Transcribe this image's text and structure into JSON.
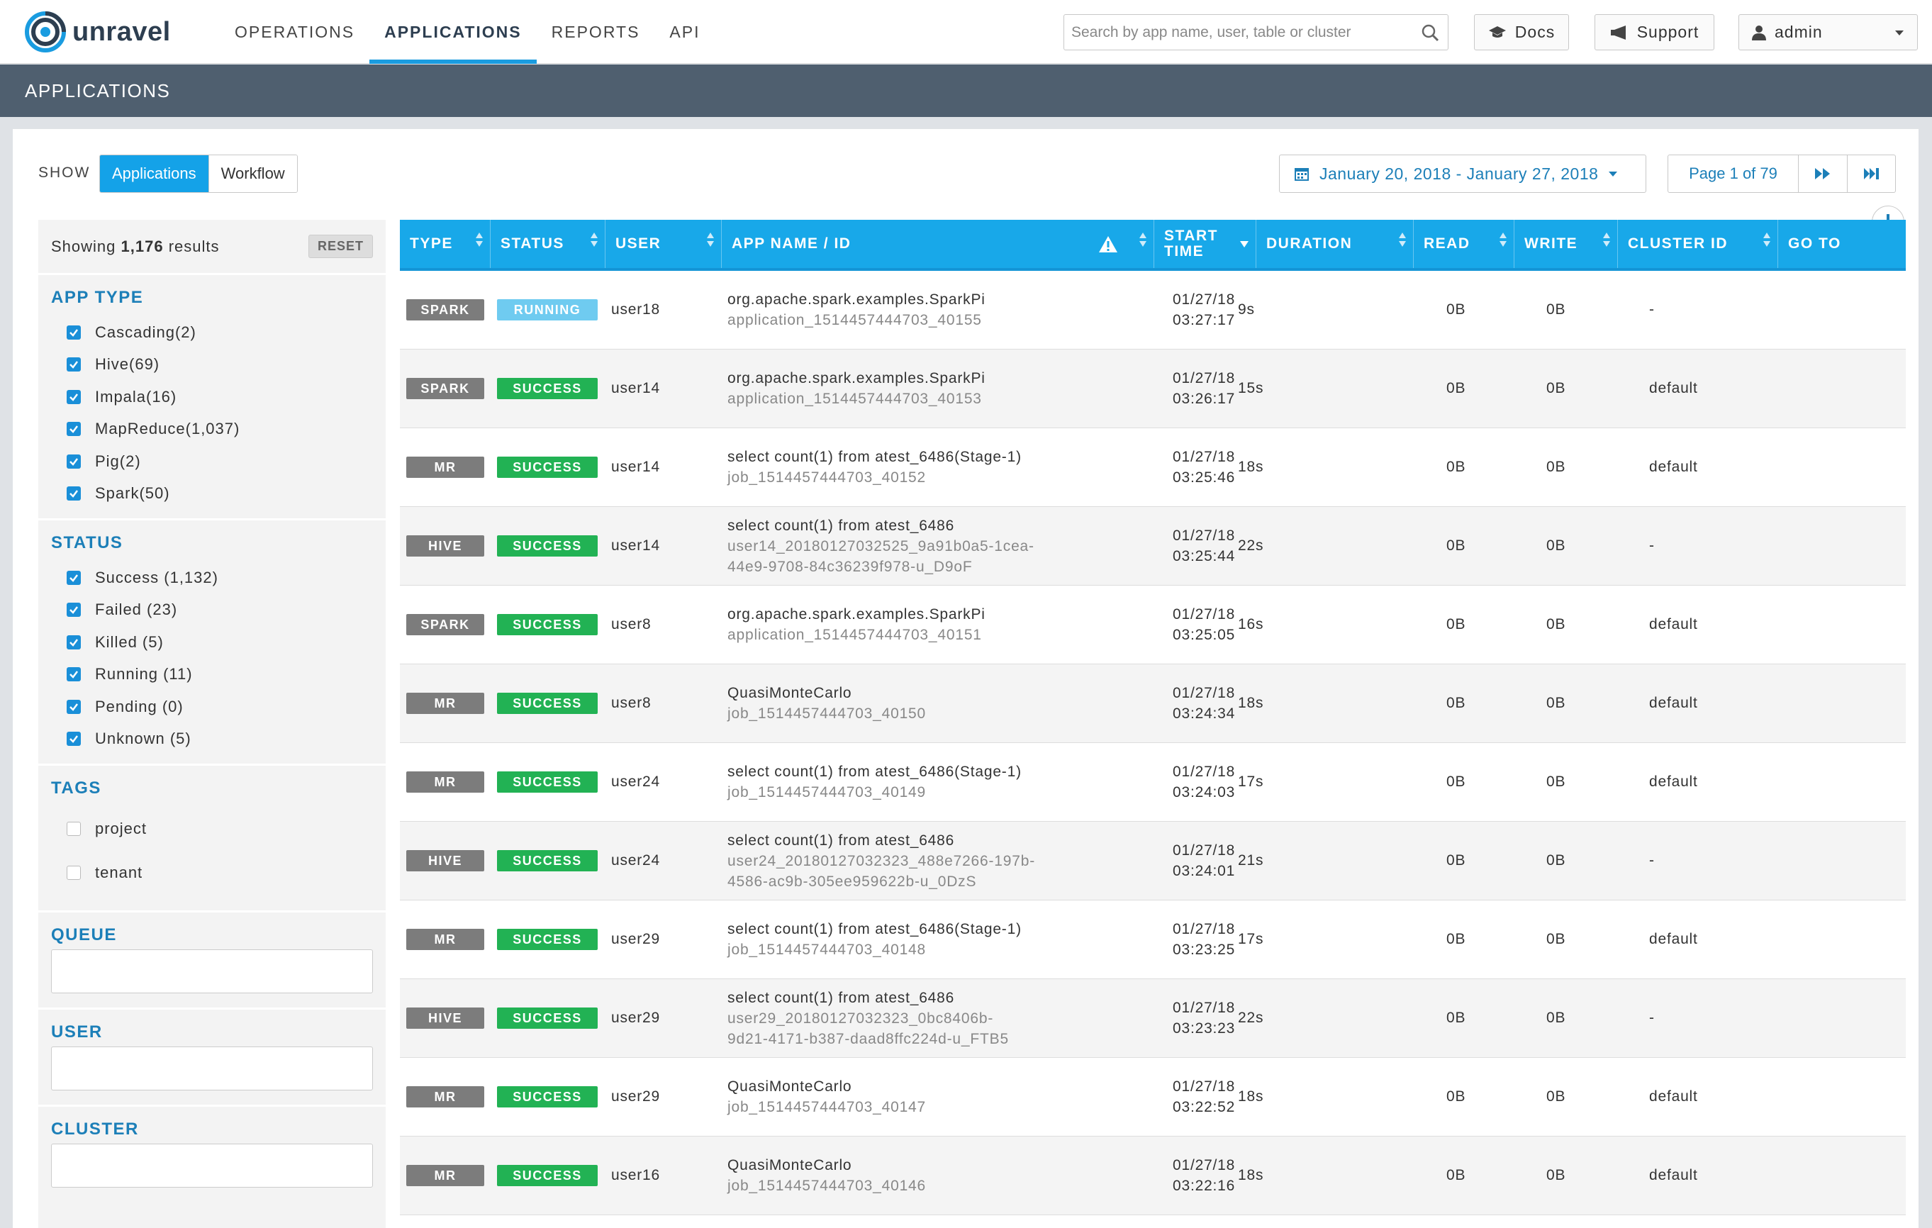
{
  "brand": {
    "name": "unravel"
  },
  "nav": {
    "items": [
      "OPERATIONS",
      "APPLICATIONS",
      "REPORTS",
      "API"
    ],
    "active_index": 1
  },
  "search": {
    "placeholder": "Search by app name, user, table or cluster"
  },
  "header_buttons": {
    "docs": "Docs",
    "support": "Support",
    "user": "admin"
  },
  "section_title": "APPLICATIONS",
  "toolbar": {
    "show_label": "SHOW",
    "show_options": [
      "Applications",
      "Workflow"
    ],
    "show_selected": "Applications",
    "date_range": "January 20, 2018 - January 27, 2018",
    "page_text": "Page 1 of 79"
  },
  "sidebar": {
    "results_prefix": "Showing ",
    "results_count": "1,176",
    "results_suffix": " results",
    "reset_label": "RESET",
    "app_type": {
      "title": "APP TYPE",
      "items": [
        {
          "label": "Cascading(2)",
          "checked": true
        },
        {
          "label": "Hive(69)",
          "checked": true
        },
        {
          "label": "Impala(16)",
          "checked": true
        },
        {
          "label": "MapReduce(1,037)",
          "checked": true
        },
        {
          "label": "Pig(2)",
          "checked": true
        },
        {
          "label": "Spark(50)",
          "checked": true
        }
      ]
    },
    "status": {
      "title": "STATUS",
      "items": [
        {
          "label": "Success (1,132)",
          "checked": true
        },
        {
          "label": "Failed (23)",
          "checked": true
        },
        {
          "label": "Killed (5)",
          "checked": true
        },
        {
          "label": "Running (11)",
          "checked": true
        },
        {
          "label": "Pending (0)",
          "checked": true
        },
        {
          "label": "Unknown (5)",
          "checked": true
        }
      ]
    },
    "tags": {
      "title": "TAGS",
      "items": [
        {
          "label": "project",
          "checked": false
        },
        {
          "label": "tenant",
          "checked": false
        }
      ]
    },
    "queue": {
      "title": "QUEUE",
      "value": ""
    },
    "user": {
      "title": "USER",
      "value": ""
    },
    "cluster": {
      "title": "CLUSTER",
      "value": ""
    }
  },
  "table": {
    "headers": {
      "type": "TYPE",
      "status": "STATUS",
      "user": "USER",
      "app_name": "APP NAME / ID",
      "start_time_1": "START",
      "start_time_2": "TIME",
      "duration": "DURATION",
      "read": "READ",
      "write": "WRITE",
      "cluster_id": "CLUSTER ID",
      "go_to": "GO TO"
    },
    "rows": [
      {
        "type": "SPARK",
        "status": "RUNNING",
        "user": "user18",
        "name": "org.apache.spark.examples.SparkPi",
        "id": [
          "application_1514457444703_40155"
        ],
        "date": "01/27/18",
        "time": "03:27:17",
        "duration": "9s",
        "read": "0B",
        "write": "0B",
        "cluster": "-"
      },
      {
        "type": "SPARK",
        "status": "SUCCESS",
        "user": "user14",
        "name": "org.apache.spark.examples.SparkPi",
        "id": [
          "application_1514457444703_40153"
        ],
        "date": "01/27/18",
        "time": "03:26:17",
        "duration": "15s",
        "read": "0B",
        "write": "0B",
        "cluster": "default"
      },
      {
        "type": "MR",
        "status": "SUCCESS",
        "user": "user14",
        "name": "select count(1) from atest_6486(Stage-1)",
        "id": [
          "job_1514457444703_40152"
        ],
        "date": "01/27/18",
        "time": "03:25:46",
        "duration": "18s",
        "read": "0B",
        "write": "0B",
        "cluster": "default"
      },
      {
        "type": "HIVE",
        "status": "SUCCESS",
        "user": "user14",
        "name": "select count(1) from atest_6486",
        "id": [
          "user14_20180127032525_9a91b0a5-1cea-",
          "44e9-9708-84c36239f978-u_D9oF"
        ],
        "date": "01/27/18",
        "time": "03:25:44",
        "duration": "22s",
        "read": "0B",
        "write": "0B",
        "cluster": "-"
      },
      {
        "type": "SPARK",
        "status": "SUCCESS",
        "user": "user8",
        "name": "org.apache.spark.examples.SparkPi",
        "id": [
          "application_1514457444703_40151"
        ],
        "date": "01/27/18",
        "time": "03:25:05",
        "duration": "16s",
        "read": "0B",
        "write": "0B",
        "cluster": "default"
      },
      {
        "type": "MR",
        "status": "SUCCESS",
        "user": "user8",
        "name": "QuasiMonteCarlo",
        "id": [
          "job_1514457444703_40150"
        ],
        "date": "01/27/18",
        "time": "03:24:34",
        "duration": "18s",
        "read": "0B",
        "write": "0B",
        "cluster": "default"
      },
      {
        "type": "MR",
        "status": "SUCCESS",
        "user": "user24",
        "name": "select count(1) from atest_6486(Stage-1)",
        "id": [
          "job_1514457444703_40149"
        ],
        "date": "01/27/18",
        "time": "03:24:03",
        "duration": "17s",
        "read": "0B",
        "write": "0B",
        "cluster": "default"
      },
      {
        "type": "HIVE",
        "status": "SUCCESS",
        "user": "user24",
        "name": "select count(1) from atest_6486",
        "id": [
          "user24_20180127032323_488e7266-197b-",
          "4586-ac9b-305ee959622b-u_0DzS"
        ],
        "date": "01/27/18",
        "time": "03:24:01",
        "duration": "21s",
        "read": "0B",
        "write": "0B",
        "cluster": "-"
      },
      {
        "type": "MR",
        "status": "SUCCESS",
        "user": "user29",
        "name": "select count(1) from atest_6486(Stage-1)",
        "id": [
          "job_1514457444703_40148"
        ],
        "date": "01/27/18",
        "time": "03:23:25",
        "duration": "17s",
        "read": "0B",
        "write": "0B",
        "cluster": "default"
      },
      {
        "type": "HIVE",
        "status": "SUCCESS",
        "user": "user29",
        "name": "select count(1) from atest_6486",
        "id": [
          "user29_20180127032323_0bc8406b-",
          "9d21-4171-b387-daad8ffc224d-u_FTB5"
        ],
        "date": "01/27/18",
        "time": "03:23:23",
        "duration": "22s",
        "read": "0B",
        "write": "0B",
        "cluster": "-"
      },
      {
        "type": "MR",
        "status": "SUCCESS",
        "user": "user29",
        "name": "QuasiMonteCarlo",
        "id": [
          "job_1514457444703_40147"
        ],
        "date": "01/27/18",
        "time": "03:22:52",
        "duration": "18s",
        "read": "0B",
        "write": "0B",
        "cluster": "default"
      },
      {
        "type": "MR",
        "status": "SUCCESS",
        "user": "user16",
        "name": "QuasiMonteCarlo",
        "id": [
          "job_1514457444703_40146"
        ],
        "date": "01/27/18",
        "time": "03:22:16",
        "duration": "18s",
        "read": "0B",
        "write": "0B",
        "cluster": "default"
      }
    ]
  },
  "icons": {
    "logo": "unravel-logo-icon",
    "search": "search-icon",
    "docs": "graduation-cap-icon",
    "support": "megaphone-icon",
    "user": "user-icon",
    "calendar": "calendar-icon",
    "warning": "warning-icon",
    "plus": "plus-icon"
  },
  "colors": {
    "accent": "#18a8e9",
    "header_bar": "#4f5f6f",
    "success": "#22b254",
    "running": "#6fcbf0",
    "type_badge": "#7c7c7c",
    "link": "#1c7fb8"
  }
}
